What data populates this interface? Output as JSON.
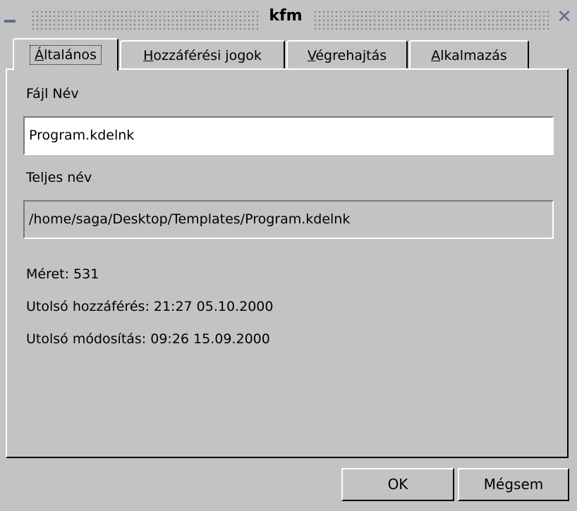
{
  "window": {
    "title": "kfm",
    "close_glyph": "✕"
  },
  "tabs": [
    {
      "label_mnemonic": "Á",
      "label_rest": "ltalános"
    },
    {
      "label_mnemonic": "H",
      "label_rest": "ozzáférési jogok"
    },
    {
      "label_mnemonic": "V",
      "label_rest": "égrehajtás"
    },
    {
      "label_mnemonic": "A",
      "label_rest": "lkalmazás"
    }
  ],
  "general": {
    "filename_label": "Fájl Név",
    "filename_value": "Program.kdelnk",
    "fullname_label": "Teljes név",
    "fullname_value": "/home/saga/Desktop/Templates/Program.kdelnk",
    "size_text": "Méret: 531",
    "last_access_text": "Utolsó hozzáférés: 21:27 05.10.2000",
    "last_modified_text": "Utolsó módosítás: 09:26 15.09.2000"
  },
  "buttons": {
    "ok": "OK",
    "cancel": "Mégsem"
  },
  "icons": {
    "minimize": "minimize-icon",
    "close": "close-icon"
  }
}
